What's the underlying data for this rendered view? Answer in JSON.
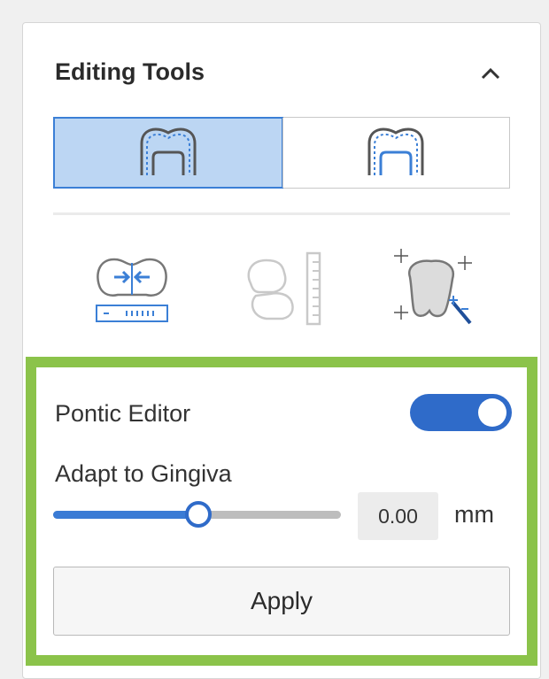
{
  "panel": {
    "title": "Editing Tools",
    "collapse_icon": "chevron-up-icon"
  },
  "mode_toggle": {
    "options": [
      {
        "icon": "crown-outer-surface-icon",
        "selected": true
      },
      {
        "icon": "crown-inner-surface-icon",
        "selected": false
      }
    ]
  },
  "tools": [
    {
      "icon": "adjust-contact-gap-icon"
    },
    {
      "icon": "measure-height-icon"
    },
    {
      "icon": "smart-shape-magic-icon"
    }
  ],
  "pontic": {
    "label": "Pontic Editor",
    "enabled": true
  },
  "gingiva": {
    "label": "Adapt to Gingiva",
    "slider_fraction": 0.5,
    "value": "0.00",
    "unit": "mm"
  },
  "apply_label": "Apply",
  "colors": {
    "accent": "#2f6bc9",
    "selected_bg": "#bcd6f3",
    "highlight": "#8bc34a"
  }
}
